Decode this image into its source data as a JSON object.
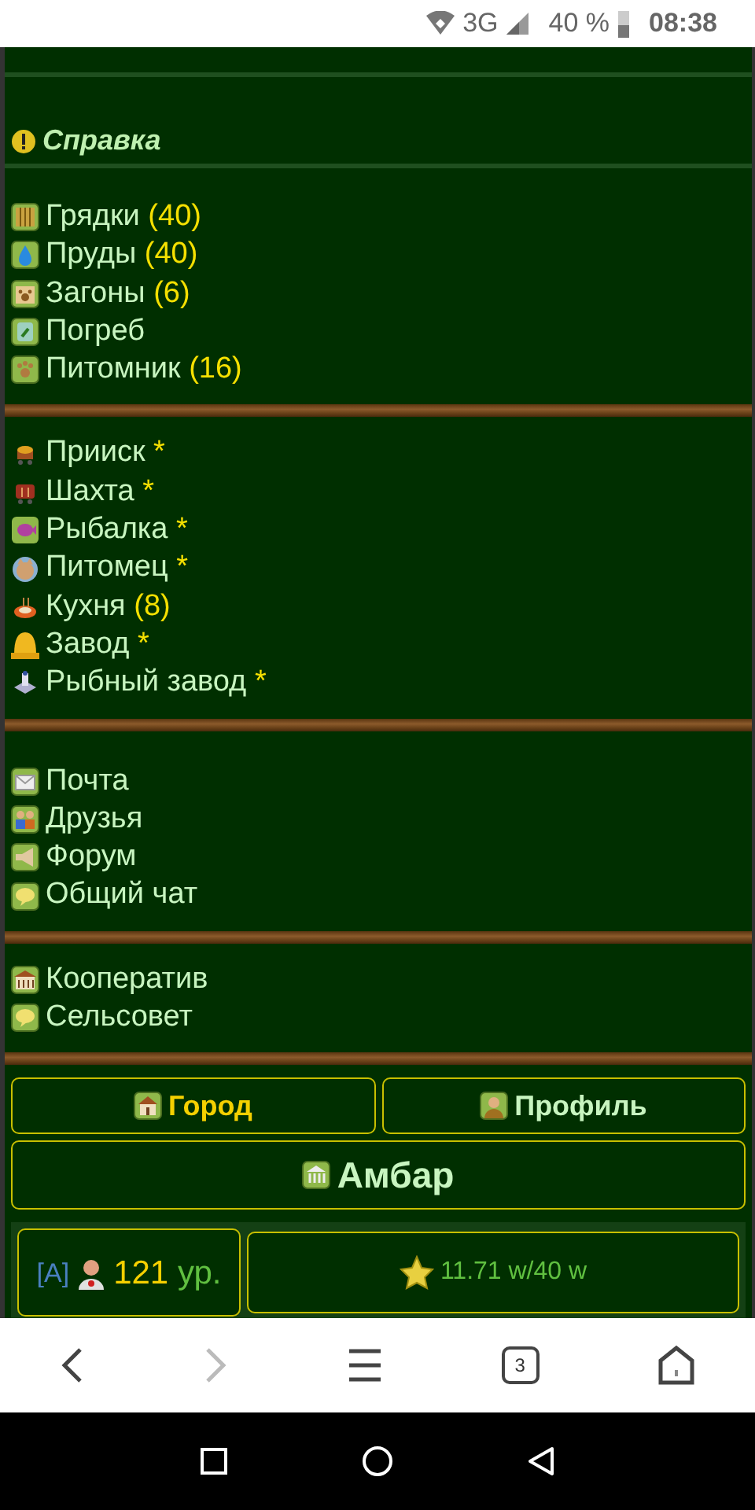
{
  "status_bar": {
    "network": "3G",
    "battery": "40 %",
    "time": "08:38"
  },
  "help": {
    "title": "Справка"
  },
  "menu_groups": [
    {
      "items": [
        {
          "label": "Грядки",
          "count": "(40)"
        },
        {
          "label": "Пруды",
          "count": "(40)"
        },
        {
          "label": "Загоны",
          "count": "(6)"
        },
        {
          "label": "Погреб"
        },
        {
          "label": "Питомник",
          "count": "(16)"
        }
      ]
    },
    {
      "items": [
        {
          "label": "Прииск",
          "count": "*"
        },
        {
          "label": "Шахта",
          "count": "*"
        },
        {
          "label": "Рыбалка",
          "count": "*"
        },
        {
          "label": "Питомец",
          "count": "*"
        },
        {
          "label": "Кухня",
          "count": "(8)"
        },
        {
          "label": "Завод",
          "count": "*"
        },
        {
          "label": "Рыбный завод",
          "count": "*"
        }
      ]
    },
    {
      "items": [
        {
          "label": "Почта"
        },
        {
          "label": "Друзья"
        },
        {
          "label": "Форум"
        },
        {
          "label": "Общий чат"
        }
      ]
    },
    {
      "items": [
        {
          "label": "Кооператив"
        },
        {
          "label": "Сельсовет"
        }
      ]
    }
  ],
  "buttons": [
    {
      "label": "Город",
      "highlighted": true
    },
    {
      "label": "Профиль",
      "highlighted": false
    }
  ],
  "barn_button": {
    "label": "Амбар"
  },
  "player": {
    "tag": "[A]",
    "level_number": "121",
    "level_unit": "ур.",
    "weight": "11.71 w/40 w"
  },
  "browser_bar": {
    "tabs_count": "3",
    "forward_disabled": true
  }
}
